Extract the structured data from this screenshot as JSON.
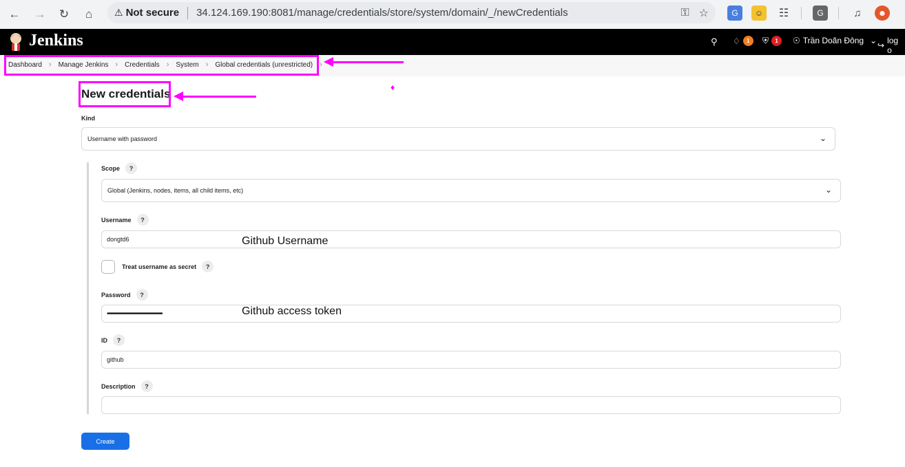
{
  "browser": {
    "security_label": "Not secure",
    "url": "34.124.169.190:8081/manage/credentials/store/system/domain/_/newCredentials"
  },
  "header": {
    "brand": "Jenkins",
    "notifications_count": "1",
    "security_count": "1",
    "user_name": "Trần Doãn Đông",
    "logout_label": "log o"
  },
  "breadcrumb": [
    "Dashboard",
    "Manage Jenkins",
    "Credentials",
    "System",
    "Global credentials (unrestricted)"
  ],
  "form": {
    "title": "New credentials",
    "kind_label": "Kind",
    "kind_value": "Username with password",
    "scope_label": "Scope",
    "scope_value": "Global (Jenkins, nodes, items, all child items, etc)",
    "username_label": "Username",
    "username_value": "dongtd6",
    "treat_secret_label": "Treat username as secret",
    "password_label": "Password",
    "password_value": "••••••••••••••••••••••••••••••••••••••••",
    "id_label": "ID",
    "id_value": "github",
    "description_label": "Description",
    "description_value": "",
    "create_label": "Create",
    "help_mark": "?"
  },
  "annotations": {
    "username_note": "Github Username",
    "password_note": "Github access token",
    "color": "#ff00ff"
  }
}
